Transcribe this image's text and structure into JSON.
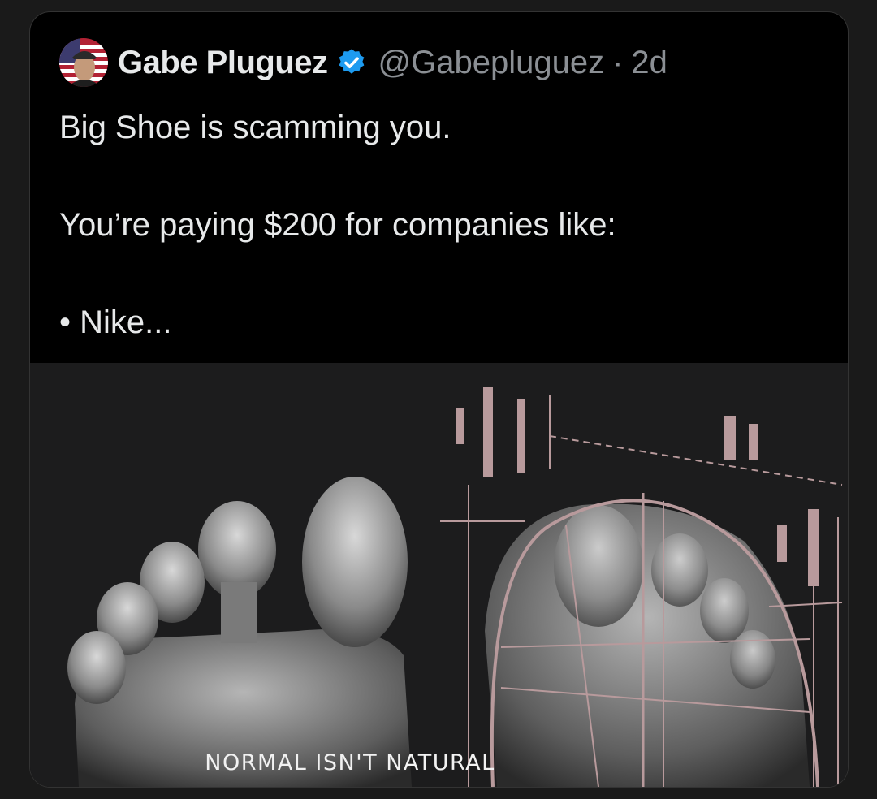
{
  "tweet": {
    "display_name": "Gabe Pluguez",
    "handle": "@Gabepluguez",
    "separator": "·",
    "time": "2d",
    "verified_icon": "verified-badge-icon",
    "lines": [
      "Big Shoe is scamming you.",
      "",
      "You’re paying $200 for companies like:",
      "",
      "• Nike..."
    ]
  },
  "media": {
    "caption": "NORMAL ISN'T NATURAL"
  },
  "colors": {
    "background": "#000000",
    "text": "#e7e9ea",
    "muted": "#8b8f94",
    "verified": "#1d9bf0",
    "diagram_lines": "#b89a9c"
  }
}
